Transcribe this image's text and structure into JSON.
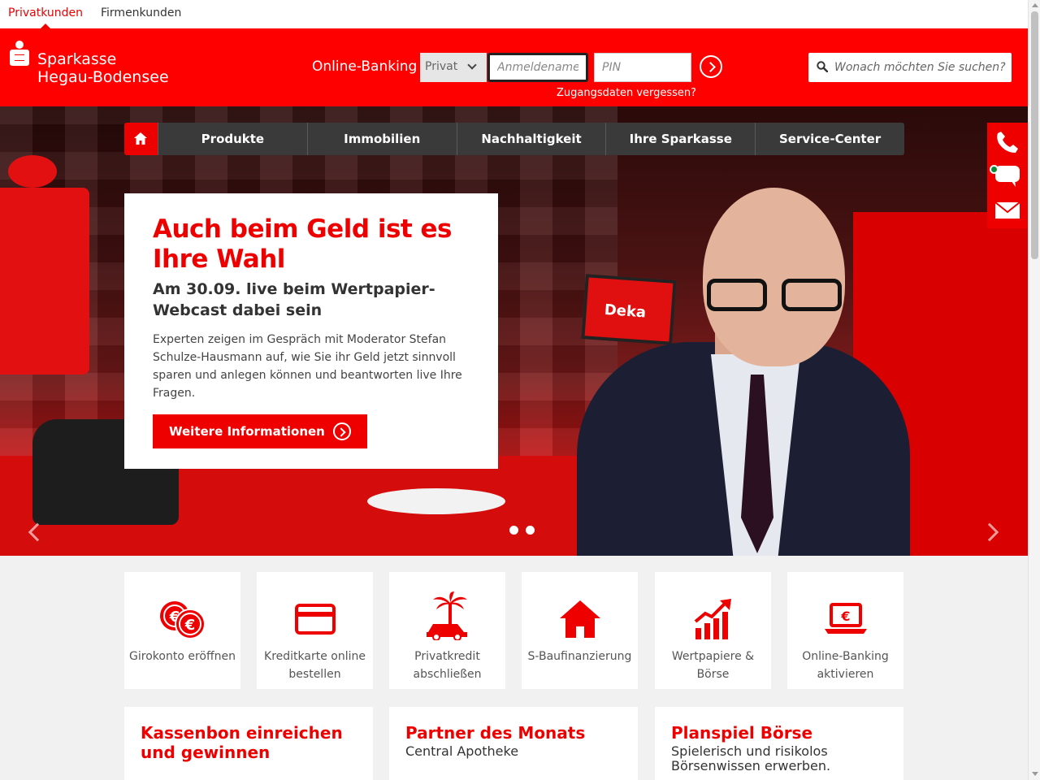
{
  "segments": {
    "private": "Privatkunden",
    "business": "Firmenkunden"
  },
  "brand": {
    "line1": "Sparkasse",
    "line2": "Hegau-Bodensee",
    "color": "#ff0000"
  },
  "login": {
    "label": "Online-Banking",
    "type_selected": "Privat",
    "username_placeholder": "Anmeldename",
    "pin_placeholder": "PIN",
    "forgot": "Zugangsdaten vergessen?"
  },
  "search": {
    "placeholder": "Wonach möchten Sie suchen?"
  },
  "nav": [
    "Produkte",
    "Immobilien",
    "Nachhaltigkeit",
    "Ihre Sparkasse",
    "Service-Center"
  ],
  "hero": {
    "title": "Auch beim Geld ist es Ihre Wahl",
    "subtitle": "Am 30.09. live beim Wertpapier-Webcast dabei sein",
    "text": "Experten zeigen im Gespräch mit Moderator Stefan Schulze-Hausmann auf, wie Sie ihr Geld jetzt sinnvoll sparen und anlegen können und beantworten live Ihre Fragen.",
    "button": "Weitere Informationen",
    "screen_logo": "Deka"
  },
  "tiles": [
    {
      "label": "Girokonto eröffnen",
      "icon": "euro-coins-icon"
    },
    {
      "label": "Kreditkarte online bestellen",
      "icon": "credit-card-icon"
    },
    {
      "label": "Privatkredit abschließen",
      "icon": "palm-car-icon"
    },
    {
      "label": "S-Baufinanzierung",
      "icon": "house-icon"
    },
    {
      "label": "Wertpapiere & Börse",
      "icon": "chart-up-icon"
    },
    {
      "label": "Online-Banking aktivieren",
      "icon": "laptop-euro-icon"
    }
  ],
  "teasers": [
    {
      "title": "Kassenbon einreichen und gewinnen",
      "sub": ""
    },
    {
      "title": "Partner des Monats",
      "sub": "Central Apotheke"
    },
    {
      "title": "Planspiel Börse",
      "sub": "Spielerisch und risikolos Börsenwissen erwerben."
    }
  ]
}
